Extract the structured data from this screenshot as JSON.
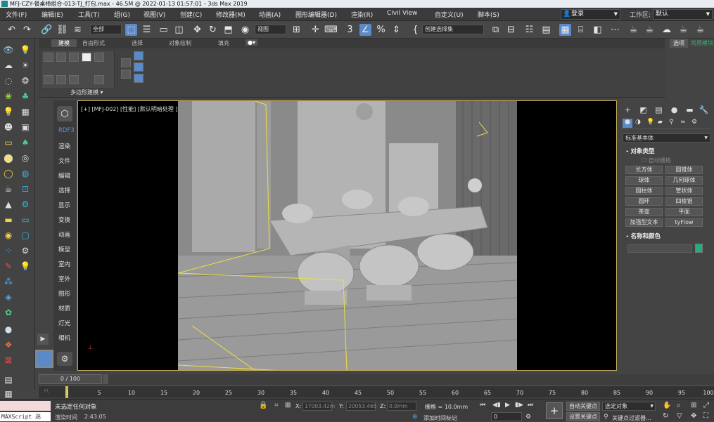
{
  "window": {
    "title": "MFJ-CZY-餐桌椅组合-013-TJ_打包.max - 46.5M @ 2022-01-13 01:57:01 - 3ds Max 2019"
  },
  "menu": {
    "items": [
      "文件(F)",
      "编辑(E)",
      "工具(T)",
      "组(G)",
      "视图(V)",
      "创建(C)",
      "修改器(M)",
      "动画(A)",
      "图形编辑器(D)",
      "渲染(R)",
      "Civil View",
      "自定义(U)",
      "脚本(S)"
    ],
    "login_label": "登录",
    "workspace_label": "工作区:",
    "workspace_value": "默认"
  },
  "toolbar": {
    "selection_filter": "全部",
    "reference_coord": "视图",
    "named_selection_set": "创建选择集"
  },
  "ribbon": {
    "tabs": [
      "建模",
      "自由形式",
      "选择",
      "对象绘制",
      "填充"
    ],
    "active_tab": "建模",
    "panel_label": "多边形建模",
    "right_tabs": [
      "选项",
      "常用模块"
    ]
  },
  "rdf_panel": {
    "title": "RDF3",
    "items": [
      "渲染",
      "文件",
      "编辑",
      "选择",
      "显示",
      "变换",
      "动画",
      "模型",
      "室内",
      "室外",
      "图形",
      "材质",
      "灯光",
      "相机"
    ]
  },
  "viewport": {
    "label": "[+] [MFJ-002] [性能] [默认明暗处理 ]"
  },
  "command_panel": {
    "category_select": "标准基本体",
    "object_type_header": "对象类型",
    "auto_grid": "自动栅格",
    "buttons": [
      "长方体",
      "圆锥体",
      "球体",
      "几何球体",
      "圆柱体",
      "管状体",
      "圆环",
      "四棱锥",
      "茶壶",
      "平面",
      "加强型文本",
      "tyFlow"
    ],
    "name_color_header": "名称和颜色",
    "object_color": "#1fb07a"
  },
  "timeline": {
    "frame_counter": "0 / 100",
    "ticks": [
      "0",
      "5",
      "10",
      "15",
      "20",
      "25",
      "30",
      "35",
      "40",
      "45",
      "50",
      "55",
      "60",
      "65",
      "70",
      "75",
      "80",
      "85",
      "90",
      "95",
      "100"
    ]
  },
  "status": {
    "maxscript_label": "MAXScript 迷",
    "selection_status": "未选定任何对象",
    "render_time_label": "渲染时间",
    "render_time": "2:43:05",
    "x_label": "X:",
    "x_value": "17003.42m",
    "y_label": "Y:",
    "y_value": "20053.465",
    "z_label": "Z:",
    "z_value": "0.0mm",
    "grid_label": "栅格 = 10.0mm",
    "add_time_tag": "添加时间标记",
    "frame_value": "0",
    "auto_key": "自动关键点",
    "set_key": "设置关键点",
    "selected_objects": "选定对象",
    "key_filter": "关键点过滤器..."
  }
}
